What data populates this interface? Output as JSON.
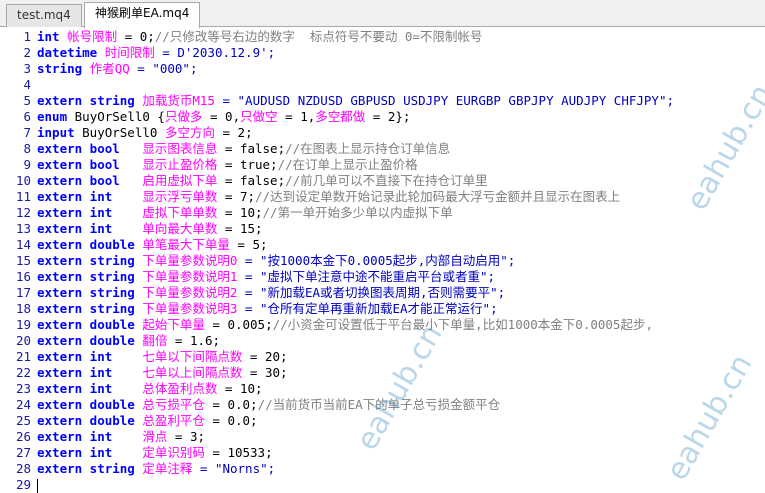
{
  "tabs": [
    {
      "label": "test.mq4"
    },
    {
      "label": "神猴刷单EA.mq4"
    }
  ],
  "watermark": "eahub.cn",
  "colors": {
    "keyword": "#0000ff",
    "identifier": "#000080",
    "chinese_ident": "#ff00ff",
    "string": "#0000c0",
    "comment": "#808080",
    "line_number": "#1a1aa6"
  },
  "lines": [
    {
      "n": "1",
      "tokens": [
        {
          "t": "int ",
          "c": "kw"
        },
        {
          "t": "帐号限制",
          "c": "cn"
        },
        {
          "t": " = 0;",
          "c": "pl"
        },
        {
          "t": "//只修改等号右边的数字  标点符号不要动 0=不限制帐号",
          "c": "cm"
        }
      ]
    },
    {
      "n": "2",
      "tokens": [
        {
          "t": "datetime ",
          "c": "kw"
        },
        {
          "t": "时间限制",
          "c": "cn"
        },
        {
          "t": " = D'2030.12.9';",
          "c": "st"
        }
      ]
    },
    {
      "n": "3",
      "tokens": [
        {
          "t": "string ",
          "c": "kw"
        },
        {
          "t": "作者QQ",
          "c": "cn"
        },
        {
          "t": " = \"000\";",
          "c": "st"
        }
      ]
    },
    {
      "n": "4",
      "tokens": []
    },
    {
      "n": "5",
      "tokens": [
        {
          "t": "extern string ",
          "c": "kw"
        },
        {
          "t": "加载货币M15",
          "c": "cn"
        },
        {
          "t": " = \"AUDUSD NZDUSD GBPUSD USDJPY EURGBP GBPJPY AUDJPY CHFJPY\";",
          "c": "st"
        }
      ]
    },
    {
      "n": "6",
      "tokens": [
        {
          "t": "enum ",
          "c": "kw"
        },
        {
          "t": "BuyOrSell0 {",
          "c": "pl"
        },
        {
          "t": "只做多",
          "c": "cn"
        },
        {
          "t": " = 0,",
          "c": "pl"
        },
        {
          "t": "只做空",
          "c": "cn"
        },
        {
          "t": " = 1,",
          "c": "pl"
        },
        {
          "t": "多空都做",
          "c": "cn"
        },
        {
          "t": " = 2};",
          "c": "pl"
        }
      ]
    },
    {
      "n": "7",
      "tokens": [
        {
          "t": "input ",
          "c": "kw"
        },
        {
          "t": "BuyOrSell0 ",
          "c": "pl"
        },
        {
          "t": "多空方向",
          "c": "cn"
        },
        {
          "t": " = 2;",
          "c": "pl"
        }
      ]
    },
    {
      "n": "8",
      "tokens": [
        {
          "t": "extern bool   ",
          "c": "kw"
        },
        {
          "t": "显示图表信息",
          "c": "cn"
        },
        {
          "t": " = false;",
          "c": "pl"
        },
        {
          "t": "//在图表上显示持仓订单信息",
          "c": "cm"
        }
      ]
    },
    {
      "n": "9",
      "tokens": [
        {
          "t": "extern bool   ",
          "c": "kw"
        },
        {
          "t": "显示止盈价格",
          "c": "cn"
        },
        {
          "t": " = true;",
          "c": "pl"
        },
        {
          "t": "//在订单上显示止盈价格",
          "c": "cm"
        }
      ]
    },
    {
      "n": "10",
      "tokens": [
        {
          "t": "extern bool   ",
          "c": "kw"
        },
        {
          "t": "启用虚拟下单",
          "c": "cn"
        },
        {
          "t": " = false;",
          "c": "pl"
        },
        {
          "t": "//前几单可以不直接下在持仓订单里",
          "c": "cm"
        }
      ]
    },
    {
      "n": "11",
      "tokens": [
        {
          "t": "extern int    ",
          "c": "kw"
        },
        {
          "t": "显示浮亏单数",
          "c": "cn"
        },
        {
          "t": " = 7;",
          "c": "pl"
        },
        {
          "t": "//达到设定单数开始记录此轮加码最大浮亏金额并且显示在图表上",
          "c": "cm"
        }
      ]
    },
    {
      "n": "12",
      "tokens": [
        {
          "t": "extern int    ",
          "c": "kw"
        },
        {
          "t": "虚拟下单单数",
          "c": "cn"
        },
        {
          "t": " = 10;",
          "c": "pl"
        },
        {
          "t": "//第一单开始多少单以内虚拟下单",
          "c": "cm"
        }
      ]
    },
    {
      "n": "13",
      "tokens": [
        {
          "t": "extern int    ",
          "c": "kw"
        },
        {
          "t": "单向最大单数",
          "c": "cn"
        },
        {
          "t": " = 15;",
          "c": "pl"
        }
      ]
    },
    {
      "n": "14",
      "tokens": [
        {
          "t": "extern double ",
          "c": "kw"
        },
        {
          "t": "单笔最大下单量",
          "c": "cn"
        },
        {
          "t": " = 5;",
          "c": "pl"
        }
      ]
    },
    {
      "n": "15",
      "tokens": [
        {
          "t": "extern string ",
          "c": "kw"
        },
        {
          "t": "下单量参数说明0",
          "c": "cn"
        },
        {
          "t": " = \"按1000本金下0.0005起步,内部自动启用\";",
          "c": "st"
        }
      ]
    },
    {
      "n": "16",
      "tokens": [
        {
          "t": "extern string ",
          "c": "kw"
        },
        {
          "t": "下单量参数说明1",
          "c": "cn"
        },
        {
          "t": " = \"虚拟下单注意中途不能重启平台或者重\";",
          "c": "st"
        }
      ]
    },
    {
      "n": "17",
      "tokens": [
        {
          "t": "extern string ",
          "c": "kw"
        },
        {
          "t": "下单量参数说明2",
          "c": "cn"
        },
        {
          "t": " = \"新加载EA或者切换图表周期,否则需要平\";",
          "c": "st"
        }
      ]
    },
    {
      "n": "18",
      "tokens": [
        {
          "t": "extern string ",
          "c": "kw"
        },
        {
          "t": "下单量参数说明3",
          "c": "cn"
        },
        {
          "t": " = \"仓所有定单再重新加载EA才能正常运行\";",
          "c": "st"
        }
      ]
    },
    {
      "n": "19",
      "tokens": [
        {
          "t": "extern double ",
          "c": "kw"
        },
        {
          "t": "起始下单量",
          "c": "cn"
        },
        {
          "t": " = 0.005;",
          "c": "pl"
        },
        {
          "t": "//小资金可设置低于平台最小下单量,比如1000本金下0.0005起步,",
          "c": "cm"
        }
      ]
    },
    {
      "n": "20",
      "tokens": [
        {
          "t": "extern double ",
          "c": "kw"
        },
        {
          "t": "翻倍",
          "c": "cn"
        },
        {
          "t": " = 1.6;",
          "c": "pl"
        }
      ]
    },
    {
      "n": "21",
      "tokens": [
        {
          "t": "extern int    ",
          "c": "kw"
        },
        {
          "t": "七单以下间隔点数",
          "c": "cn"
        },
        {
          "t": " = 20;",
          "c": "pl"
        }
      ]
    },
    {
      "n": "22",
      "tokens": [
        {
          "t": "extern int    ",
          "c": "kw"
        },
        {
          "t": "七单以上间隔点数",
          "c": "cn"
        },
        {
          "t": " = 30;",
          "c": "pl"
        }
      ]
    },
    {
      "n": "23",
      "tokens": [
        {
          "t": "extern int    ",
          "c": "kw"
        },
        {
          "t": "总体盈利点数",
          "c": "cn"
        },
        {
          "t": " = 10;",
          "c": "pl"
        }
      ]
    },
    {
      "n": "24",
      "tokens": [
        {
          "t": "extern double ",
          "c": "kw"
        },
        {
          "t": "总亏损平仓",
          "c": "cn"
        },
        {
          "t": " = 0.0;",
          "c": "pl"
        },
        {
          "t": "//当前货币当前EA下的单子总亏损金额平仓",
          "c": "cm"
        }
      ]
    },
    {
      "n": "25",
      "tokens": [
        {
          "t": "extern double ",
          "c": "kw"
        },
        {
          "t": "总盈利平仓",
          "c": "cn"
        },
        {
          "t": " = 0.0;",
          "c": "pl"
        }
      ]
    },
    {
      "n": "26",
      "tokens": [
        {
          "t": "extern int    ",
          "c": "kw"
        },
        {
          "t": "滑点",
          "c": "cn"
        },
        {
          "t": " = 3;",
          "c": "pl"
        }
      ]
    },
    {
      "n": "27",
      "tokens": [
        {
          "t": "extern int    ",
          "c": "kw"
        },
        {
          "t": "定单识别码",
          "c": "cn"
        },
        {
          "t": " = 10533;",
          "c": "pl"
        }
      ]
    },
    {
      "n": "28",
      "tokens": [
        {
          "t": "extern string ",
          "c": "kw"
        },
        {
          "t": "定单注释",
          "c": "cn"
        },
        {
          "t": " = \"Norns\";",
          "c": "st"
        }
      ]
    },
    {
      "n": "29",
      "tokens": []
    }
  ]
}
